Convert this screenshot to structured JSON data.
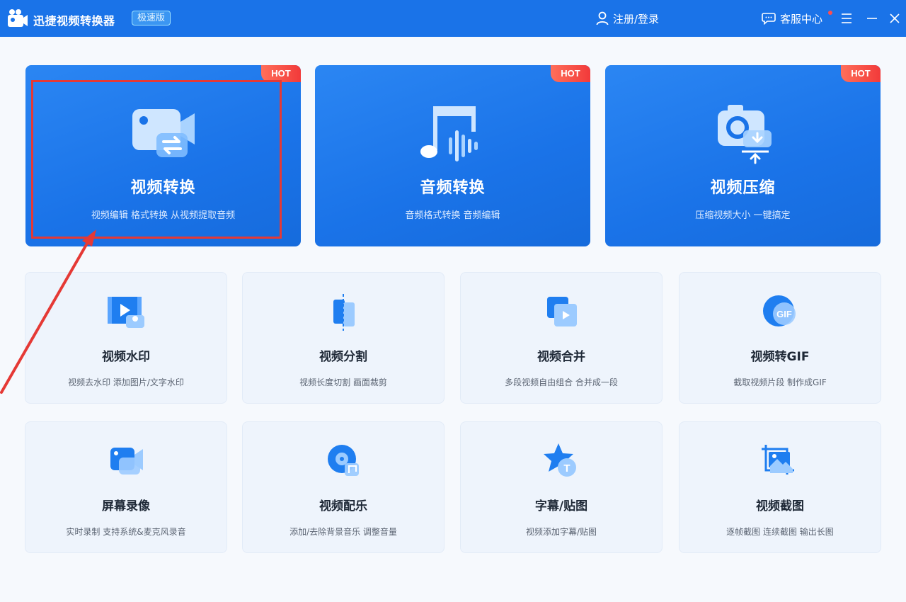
{
  "app": {
    "title": "迅捷视频转换器",
    "edition": "极速版",
    "login_label": "注册/登录",
    "service_label": "客服中心"
  },
  "colors": {
    "brand": "#1a73e8",
    "hot": "#f23a3a",
    "highlight": "#e53935"
  },
  "featured": [
    {
      "title": "视频转换",
      "desc": "视频编辑 格式转换 从视频提取音频",
      "badge": "HOT",
      "icon": "video-convert-icon"
    },
    {
      "title": "音频转换",
      "desc": "音频格式转换 音频编辑",
      "badge": "HOT",
      "icon": "audio-convert-icon"
    },
    {
      "title": "视频压缩",
      "desc": "压缩视频大小 一键搞定",
      "badge": "HOT",
      "icon": "video-compress-icon"
    }
  ],
  "tools": [
    {
      "title": "视频水印",
      "desc": "视频去水印 添加图片/文字水印",
      "icon": "watermark-icon"
    },
    {
      "title": "视频分割",
      "desc": "视频长度切割 画面裁剪",
      "icon": "split-icon"
    },
    {
      "title": "视频合并",
      "desc": "多段视频自由组合 合并成一段",
      "icon": "merge-icon"
    },
    {
      "title": "视频转GIF",
      "desc": "截取视频片段 制作成GIF",
      "icon": "gif-icon",
      "icon_text": "GIF"
    },
    {
      "title": "屏幕录像",
      "desc": "实时录制 支持系统&麦克风录音",
      "icon": "screen-record-icon"
    },
    {
      "title": "视频配乐",
      "desc": "添加/去除背景音乐 调整音量",
      "icon": "music-icon"
    },
    {
      "title": "字幕/贴图",
      "desc": "视频添加字幕/贴图",
      "icon": "subtitle-icon",
      "icon_text": "T"
    },
    {
      "title": "视频截图",
      "desc": "逐帧截图 连续截图 输出长图",
      "icon": "screenshot-icon"
    }
  ]
}
